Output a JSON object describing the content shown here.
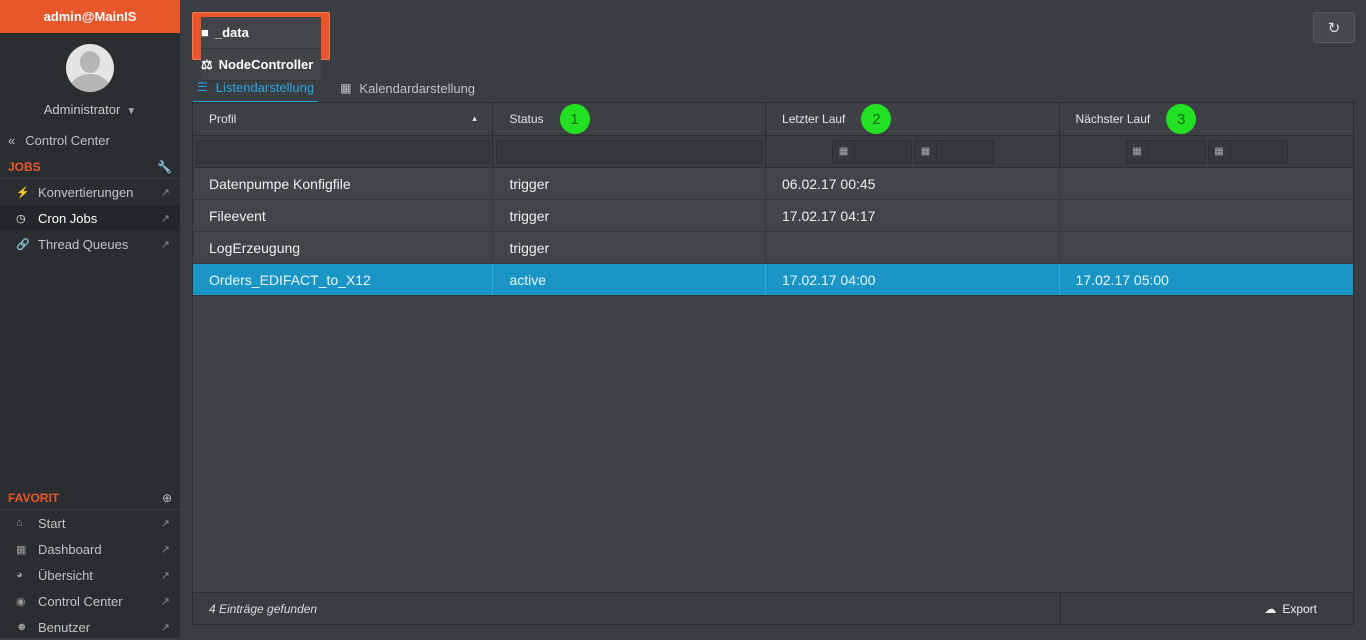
{
  "sidebar": {
    "user": "admin@MainIS",
    "role": "Administrator",
    "back_link": "Control Center",
    "jobs_title": "JOBS",
    "jobs_items": [
      {
        "label": "Konvertierungen",
        "icon": "bolt-icon"
      },
      {
        "label": "Cron Jobs",
        "icon": "clock-icon",
        "active": true
      },
      {
        "label": "Thread Queues",
        "icon": "link-icon"
      }
    ],
    "favorit_title": "FAVORIT",
    "favorit_items": [
      {
        "label": "Start",
        "icon": "home-icon"
      },
      {
        "label": "Dashboard",
        "icon": "th-large-icon"
      },
      {
        "label": "Übersicht",
        "icon": "pie-chart-icon"
      },
      {
        "label": "Control Center",
        "icon": "dashboard-icon"
      },
      {
        "label": "Benutzer",
        "icon": "users-icon"
      }
    ]
  },
  "controller": {
    "line1": "_data",
    "line2": "NodeController"
  },
  "tabs": [
    {
      "label": "Listendarstellung",
      "active": true
    },
    {
      "label": "Kalendardarstellung",
      "active": false
    }
  ],
  "grid": {
    "columns": [
      {
        "label": "Profil",
        "badge": ""
      },
      {
        "label": "Status",
        "badge": "1"
      },
      {
        "label": "Letzter Lauf",
        "badge": "2"
      },
      {
        "label": "Nächster Lauf",
        "badge": "3"
      }
    ],
    "rows": [
      {
        "profil": "Datenpumpe Konfigfile",
        "status": "trigger",
        "letzter": "06.02.17 00:45",
        "naechster": ""
      },
      {
        "profil": "Fileevent",
        "status": "trigger",
        "letzter": "17.02.17 04:17",
        "naechster": ""
      },
      {
        "profil": "LogErzeugung",
        "status": "trigger",
        "letzter": "",
        "naechster": ""
      },
      {
        "profil": "Orders_EDIFACT_to_X12",
        "status": "active",
        "letzter": "17.02.17 04:00",
        "naechster": "17.02.17 05:00",
        "selected": true
      }
    ],
    "footer_count": "4 Einträge gefunden",
    "export_label": "Export"
  },
  "colors": {
    "accent": "#e8572a",
    "selection": "#1a96c6",
    "tab_active": "#29a6de",
    "badge": "#22e022"
  }
}
